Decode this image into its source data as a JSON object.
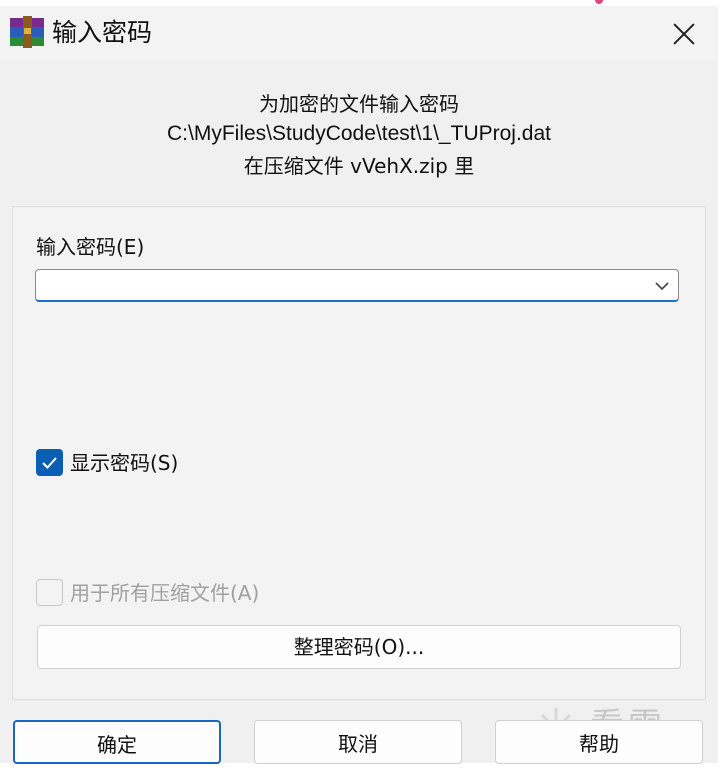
{
  "window": {
    "title": "输入密码",
    "app_icon": "winrar-icon",
    "close_icon": "close-icon"
  },
  "info": {
    "line1": "为加密的文件输入密码",
    "file_path": "C:\\MyFiles\\StudyCode\\test\\1\\_TUProj.dat",
    "line3": "在压缩文件 vVehX.zip 里"
  },
  "password": {
    "label": "输入密码(E)",
    "value": "",
    "dropdown_icon": "chevron-down-icon"
  },
  "show_password": {
    "label": "显示密码(S)",
    "checked": true
  },
  "use_for_all": {
    "label": "用于所有压缩文件(A)",
    "checked": false,
    "enabled": false
  },
  "organize_button": {
    "label": "整理密码(O)..."
  },
  "buttons": {
    "ok": "确定",
    "cancel": "取消",
    "help": "帮助"
  },
  "watermark": {
    "text": "看雪"
  },
  "colors": {
    "accent": "#0a5fb4",
    "dialog_bg": "#f0f0f0"
  }
}
